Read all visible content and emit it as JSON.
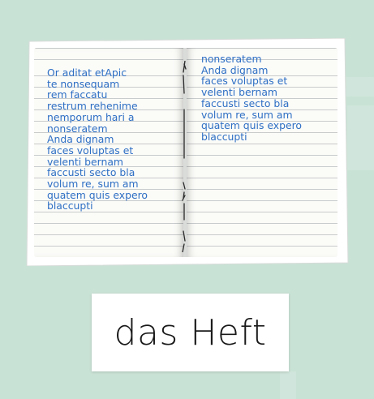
{
  "colors": {
    "background": "#c9e2d6",
    "handwriting": "#2e6fc4",
    "page": "#fbfbf8",
    "ruled_line": "#c9cccc"
  },
  "notebook": {
    "left_page_lines": [
      "Or aditat etApic",
      "te nonsequam",
      "rem faccatu",
      "restrum rehenime",
      "nemporum hari a",
      "nonseratem",
      "Anda dignam",
      "faces voluptas et",
      "velenti bernam",
      "faccusti secto bla",
      "volum re, sum am",
      "quatem quis expero",
      "blaccupti"
    ],
    "right_page_lines": [
      "nonseratem",
      "Anda dignam",
      "faces voluptas et",
      "velenti bernam",
      "faccusti secto bla",
      "volum re, sum am",
      "quatem quis expero",
      "blaccupti"
    ]
  },
  "label": {
    "text": "das Heft"
  }
}
